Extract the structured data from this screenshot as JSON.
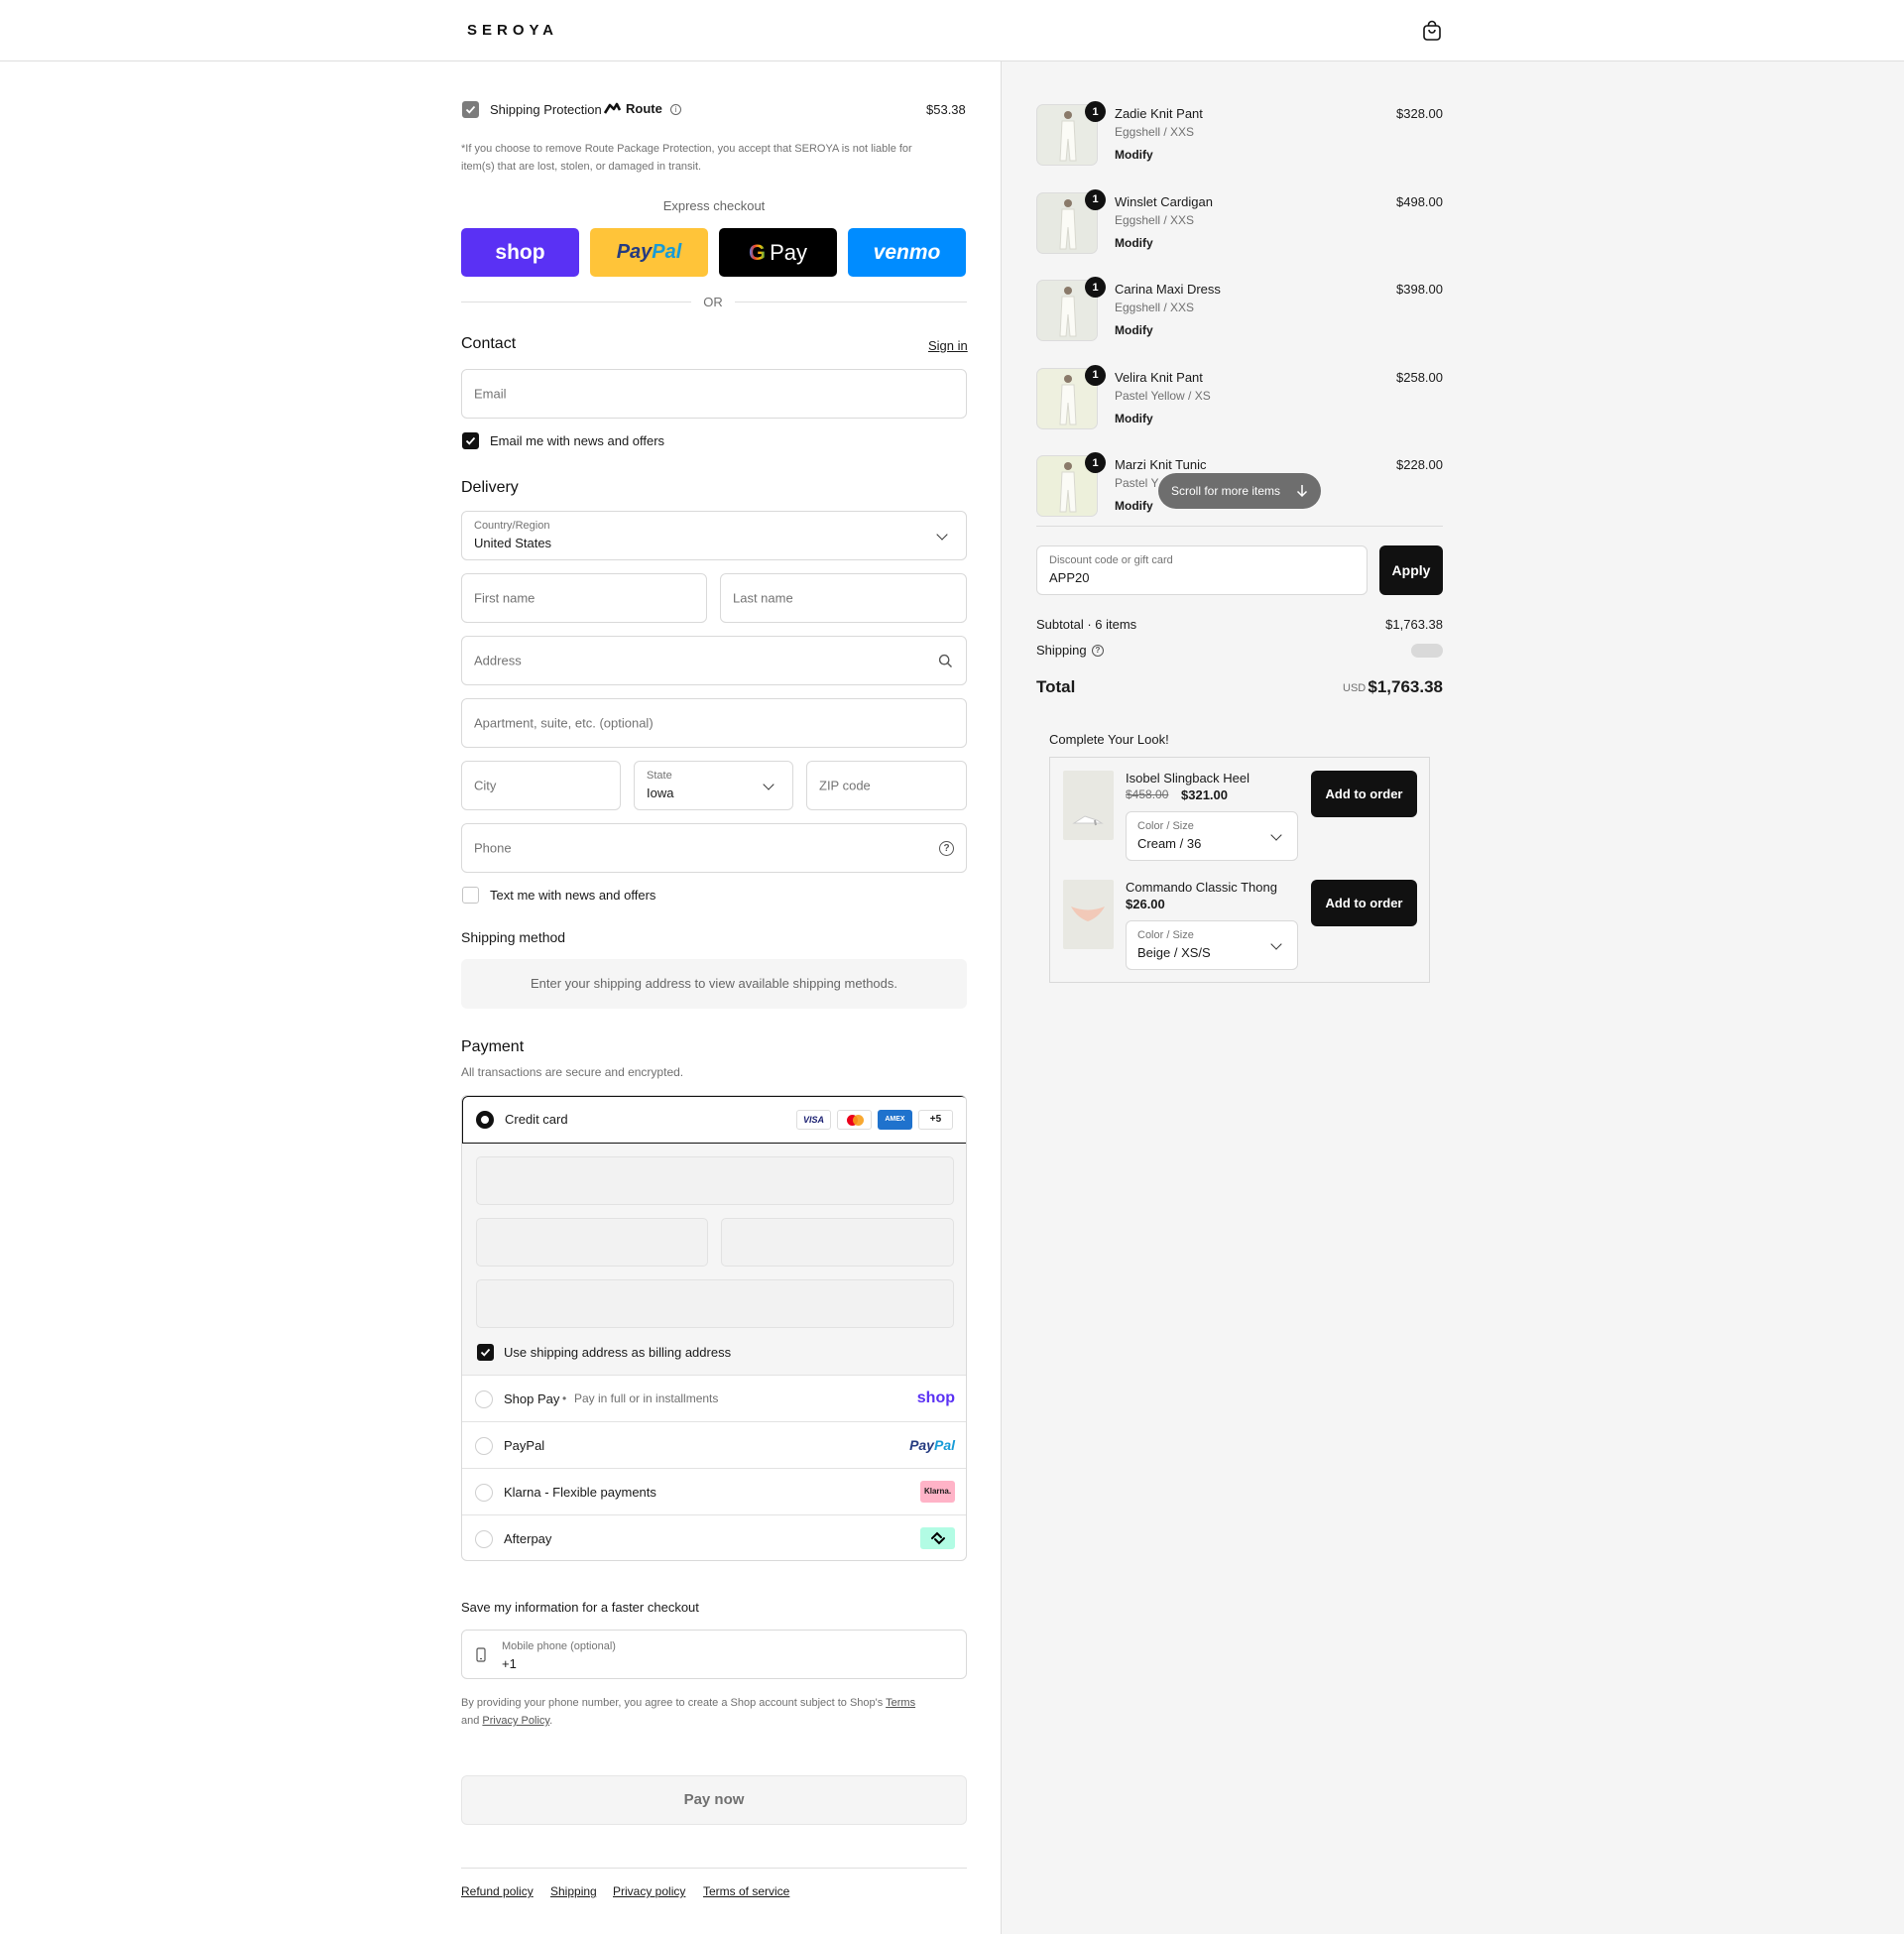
{
  "header": {
    "logo": "SEROYA"
  },
  "protection": {
    "label": "Shipping Protection",
    "brand": "Route",
    "price": "$53.38",
    "note_line1": "*If you choose to remove Route Package Protection, you accept that SEROYA is not liable for",
    "note_line2": "item(s) that are lost, stolen, or damaged in transit."
  },
  "express": {
    "title": "Express checkout",
    "shop": "shop",
    "paypal_a": "Pay",
    "paypal_b": "Pal",
    "gpay": "Pay",
    "venmo": "venmo",
    "or": "OR"
  },
  "contact": {
    "title": "Contact",
    "signin": "Sign in",
    "email_placeholder": "Email",
    "news_label": "Email me with news and offers"
  },
  "delivery": {
    "title": "Delivery",
    "country_label": "Country/Region",
    "country_value": "United States",
    "first_name": "First name",
    "last_name": "Last name",
    "address": "Address",
    "apartment": "Apartment, suite, etc. (optional)",
    "city": "City",
    "state_label": "State",
    "state_value": "Iowa",
    "zip": "ZIP code",
    "phone": "Phone",
    "text_label": "Text me with news and offers"
  },
  "shipping_method": {
    "title": "Shipping method",
    "message": "Enter your shipping address to view available shipping methods."
  },
  "payment": {
    "title": "Payment",
    "subtitle": "All transactions are secure and encrypted.",
    "credit_card": "Credit card",
    "visa": "VISA",
    "amex": "AMEX",
    "more": "+5",
    "billing_label": "Use shipping address as billing address",
    "shop_pay": "Shop Pay",
    "shop_pay_sub": "Pay in full or in installments",
    "shop_logo": "shop",
    "paypal": "PayPal",
    "paypal_logo_a": "Pay",
    "paypal_logo_b": "Pal",
    "klarna": "Klarna - Flexible payments",
    "klarna_logo": "Klarna.",
    "afterpay": "Afterpay"
  },
  "save": {
    "title": "Save my information for a faster checkout",
    "phone_label": "Mobile phone (optional)",
    "phone_value": "+1",
    "legal_1": "By providing your phone number, you agree to create a Shop account subject to Shop's",
    "terms": "Terms",
    "legal_2": "and",
    "privacy": "Privacy Policy",
    "legal_3": "."
  },
  "pay_now": "Pay now",
  "footer": {
    "links": [
      "Refund policy",
      "Shipping",
      "Privacy policy",
      "Terms of service"
    ]
  },
  "cart": {
    "items": [
      {
        "name": "Zadie Knit Pant",
        "variant": "Eggshell / XXS",
        "price": "$328.00",
        "qty": "1",
        "action": "Modify",
        "tone": "#e9ebe4"
      },
      {
        "name": "Winslet Cardigan",
        "variant": "Eggshell / XXS",
        "price": "$498.00",
        "qty": "1",
        "action": "Modify",
        "tone": "#e7e9e2"
      },
      {
        "name": "Carina Maxi Dress",
        "variant": "Eggshell / XXS",
        "price": "$398.00",
        "qty": "1",
        "action": "Modify",
        "tone": "#e8eae3"
      },
      {
        "name": "Velira Knit Pant",
        "variant": "Pastel Yellow / XS",
        "price": "$258.00",
        "qty": "1",
        "action": "Modify",
        "tone": "#eef0df"
      },
      {
        "name": "Marzi Knit Tunic",
        "variant": "Pastel Y",
        "price": "$228.00",
        "qty": "1",
        "action": "Modify",
        "tone": "#edf0db"
      }
    ],
    "scroll_hint": "Scroll for more items"
  },
  "discount": {
    "label": "Discount code or gift card",
    "value": "APP20",
    "apply": "Apply"
  },
  "summary": {
    "subtotal_label": "Subtotal · 6 items",
    "subtotal": "$1,763.38",
    "shipping_label": "Shipping",
    "total_label": "Total",
    "currency": "USD",
    "total": "$1,763.38"
  },
  "upsell": {
    "title": "Complete Your Look!",
    "products": [
      {
        "name": "Isobel Slingback Heel",
        "old_price": "$458.00",
        "price": "$321.00",
        "option_label": "Color / Size",
        "option_value": "Cream / 36",
        "button": "Add to order"
      },
      {
        "name": "Commando Classic Thong",
        "old_price": "",
        "price": "$26.00",
        "option_label": "Color / Size",
        "option_value": "Beige / XS/S",
        "button": "Add to order"
      }
    ]
  },
  "colors": {
    "shop_purple": "#5a31f4",
    "paypal_yellow": "#ffc439",
    "venmo_blue": "#008cff",
    "black": "#111111"
  }
}
